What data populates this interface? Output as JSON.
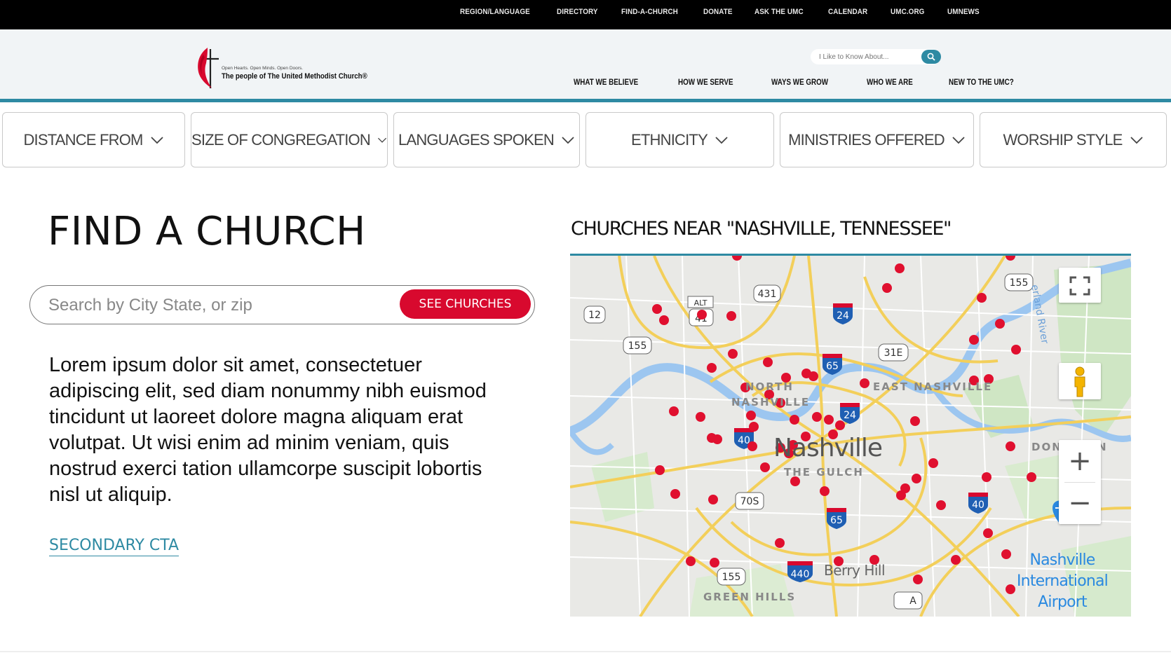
{
  "utility_nav": [
    "REGION/LANGUAGE",
    "DIRECTORY",
    "FIND-A-CHURCH",
    "DONATE",
    "ASK THE UMC",
    "CALENDAR",
    "UMC.ORG",
    "UMNEWS"
  ],
  "brand": {
    "tagline": "Open Hearts. Open Minds. Open Doors.",
    "org_name": "The people of The United Methodist Church®"
  },
  "header_search": {
    "placeholder": "I Like to Know About..."
  },
  "main_nav": [
    "WHAT WE BELIEVE",
    "HOW WE SERVE",
    "WAYS WE GROW",
    "WHO WE ARE",
    "NEW TO THE UMC?"
  ],
  "filters": [
    "DISTANCE FROM",
    "SIZE OF CONGREGATION",
    "LANGUAGES SPOKEN",
    "ETHNICITY",
    "MINISTRIES OFFERED",
    "WORSHIP STYLE"
  ],
  "page": {
    "title": "FIND A CHURCH",
    "search_placeholder": "Search by City State, or zip",
    "search_button": "SEE CHURCHES",
    "body_text": "Lorem ipsum dolor sit amet, consectetuer adipiscing elit, sed diam nonummy nibh euismod tincidunt ut laoreet dolore magna aliquam erat volutpat. Ut wisi enim ad minim veniam, quis nostrud exerci tation ullamcorpe suscipit lobortis nisl ut aliquip.",
    "secondary_cta": "SECONDARY CTA"
  },
  "map": {
    "title": "CHURCHES NEAR \"NASHVILLE, TENNESSEE\"",
    "city_label": "Nashville",
    "area_labels": [
      "NORTH",
      "NASHVILLE",
      "EAST NASHVILLE",
      "THE GULCH",
      "Berry Hill",
      "GREEN HILLS",
      "DON",
      "N"
    ],
    "airport_label": [
      "Nashville",
      "International",
      "Airport"
    ],
    "river_label": "erland River",
    "shields": [
      "431",
      "24",
      "12",
      "ALT",
      "41",
      "155",
      "31E",
      "65",
      "24",
      "40",
      "70S",
      "65",
      "440",
      "155",
      "40",
      "155"
    ],
    "zoom_in": "+",
    "zoom_out": "−",
    "marker_color": "#e0102f"
  },
  "colors": {
    "accent": "#2e8aa3",
    "cta": "#d8092e",
    "marker": "#e0102f"
  }
}
